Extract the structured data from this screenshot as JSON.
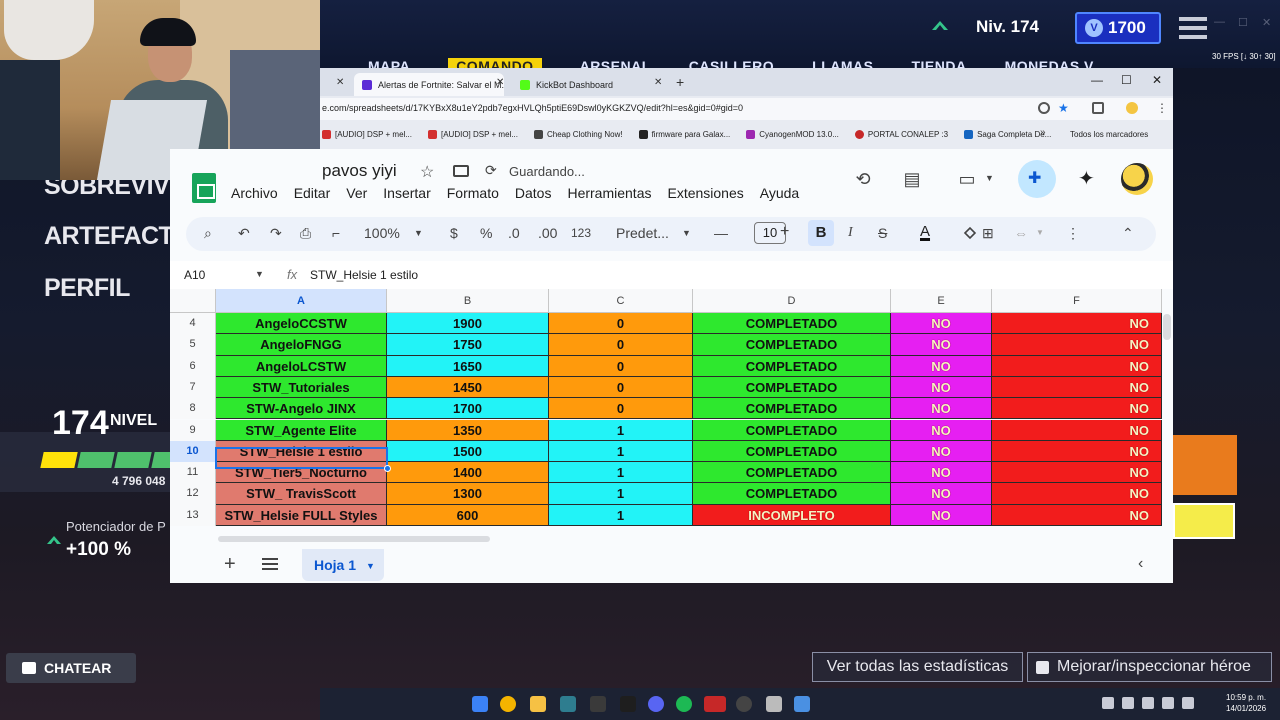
{
  "game": {
    "tabs": [
      "MAPA",
      "COMANDO",
      "ARSENAL",
      "CASILLERO",
      "LLAMAS",
      "TIENDA",
      "MONEDAS V"
    ],
    "level_label": "Niv. 174",
    "vbucks": "1700",
    "fps": "30 FPS [↓ 30↑ 30]",
    "side_menu": [
      "SOBREVIVIENTES",
      "ARTEFACTOS",
      "PERFIL"
    ],
    "level_number": "174",
    "level_word": "NIVEL",
    "xp_value": "4 796 048",
    "boost_label": "Potenciador de P",
    "boost_value": "+100 %",
    "chat_label": "CHATEAR",
    "stats_button": "Ver todas las estadísticas",
    "hero_button": "Mejorar/inspeccionar héroe",
    "clock_time": "10:59 p. m.",
    "clock_date": "14/01/2026"
  },
  "browser": {
    "tabs": [
      {
        "title": "Alertas de Fortnite: Salvar el M...",
        "color": "#5b2bd6"
      },
      {
        "title": "KickBot Dashboard",
        "color": "#53fc18"
      }
    ],
    "url": "e.com/spreadsheets/d/17KYBxX8u1eY2pdb7egxHVLQh5ptiE69Dswl0yKGKZVQ/edit?hl=es&gid=0#gid=0",
    "bookmarks": [
      {
        "label": "[AUDIO] DSP + mel...",
        "color": "#d32f2f"
      },
      {
        "label": "[AUDIO] DSP + mel...",
        "color": "#d32f2f"
      },
      {
        "label": "Cheap Clothing Now!",
        "color": "#444"
      },
      {
        "label": "firmware para Galax...",
        "color": "#222"
      },
      {
        "label": "CyanogenMOD 13.0...",
        "color": "#9c27b0"
      },
      {
        "label": "PORTAL CONALEP :3",
        "color": "#c62828"
      },
      {
        "label": "Saga Completa De...",
        "color": "#1565c0"
      }
    ],
    "all_bookmarks": "Todos los marcadores"
  },
  "sheets": {
    "title": "pavos yiyi",
    "saving": "Guardando...",
    "menu": [
      "Archivo",
      "Editar",
      "Ver",
      "Insertar",
      "Formato",
      "Datos",
      "Herramientas",
      "Extensiones",
      "Ayuda"
    ],
    "toolbar": {
      "zoom": "100%",
      "currency": "$",
      "percent": "%",
      "dec_less": ".0",
      "dec_more": ".00",
      "num_format": "123",
      "font": "Predet...",
      "font_size": "10",
      "bold": "B",
      "italic": "I",
      "strike": "S",
      "text_color": "A"
    },
    "name_box": "A10",
    "formula": "STW_Helsie 1 estilo",
    "columns": [
      "A",
      "B",
      "C",
      "D",
      "E",
      "F"
    ],
    "rows": [
      {
        "n": "4",
        "a": "AngeloCCSTW",
        "b": "1900",
        "c": "0",
        "d": "COMPLETADO",
        "e": "NO",
        "f": "NO",
        "ac": "#2ee82e",
        "bc": "#22f3f7",
        "cc": "#ff9a0c",
        "dc": "#2ee82e"
      },
      {
        "n": "5",
        "a": "AngeloFNGG",
        "b": "1750",
        "c": "0",
        "d": "COMPLETADO",
        "e": "NO",
        "f": "NO",
        "ac": "#2ee82e",
        "bc": "#22f3f7",
        "cc": "#ff9a0c",
        "dc": "#2ee82e"
      },
      {
        "n": "6",
        "a": "AngeloLCSTW",
        "b": "1650",
        "c": "0",
        "d": "COMPLETADO",
        "e": "NO",
        "f": "NO",
        "ac": "#2ee82e",
        "bc": "#22f3f7",
        "cc": "#ff9a0c",
        "dc": "#2ee82e"
      },
      {
        "n": "7",
        "a": "STW_Tutoriales",
        "b": "1450",
        "c": "0",
        "d": "COMPLETADO",
        "e": "NO",
        "f": "NO",
        "ac": "#2ee82e",
        "bc": "#ff9a0c",
        "cc": "#ff9a0c",
        "dc": "#2ee82e"
      },
      {
        "n": "8",
        "a": "STW-Angelo JINX",
        "b": "1700",
        "c": "0",
        "d": "COMPLETADO",
        "e": "NO",
        "f": "NO",
        "ac": "#2ee82e",
        "bc": "#22f3f7",
        "cc": "#ff9a0c",
        "dc": "#2ee82e"
      },
      {
        "n": "9",
        "a": "STW_Agente Elite",
        "b": "1350",
        "c": "1",
        "d": "COMPLETADO",
        "e": "NO",
        "f": "NO",
        "ac": "#2ee82e",
        "bc": "#ff9a0c",
        "cc": "#22f3f7",
        "dc": "#2ee82e"
      },
      {
        "n": "10",
        "a": "STW_Helsie 1 estilo",
        "b": "1500",
        "c": "1",
        "d": "COMPLETADO",
        "e": "NO",
        "f": "NO",
        "ac": "#e07a6e",
        "bc": "#22f3f7",
        "cc": "#22f3f7",
        "dc": "#2ee82e"
      },
      {
        "n": "11",
        "a": "STW_Tier5_Nocturno",
        "b": "1400",
        "c": "1",
        "d": "COMPLETADO",
        "e": "NO",
        "f": "NO",
        "ac": "#e07a6e",
        "bc": "#ff9a0c",
        "cc": "#22f3f7",
        "dc": "#2ee82e"
      },
      {
        "n": "12",
        "a": "STW_ TravisScott",
        "b": "1300",
        "c": "1",
        "d": "COMPLETADO",
        "e": "NO",
        "f": "NO",
        "ac": "#e07a6e",
        "bc": "#ff9a0c",
        "cc": "#22f3f7",
        "dc": "#2ee82e"
      },
      {
        "n": "13",
        "a": "STW_Helsie FULL Styles",
        "b": "600",
        "c": "1",
        "d": "INCOMPLETO",
        "e": "NO",
        "f": "NO",
        "ac": "#e07a6e",
        "bc": "#ff9a0c",
        "cc": "#22f3f7",
        "dc": "#f21c1c"
      }
    ],
    "e_color": "#e61ff2",
    "f_color": "#f21c1c",
    "sheet_tab": "Hoja 1"
  }
}
